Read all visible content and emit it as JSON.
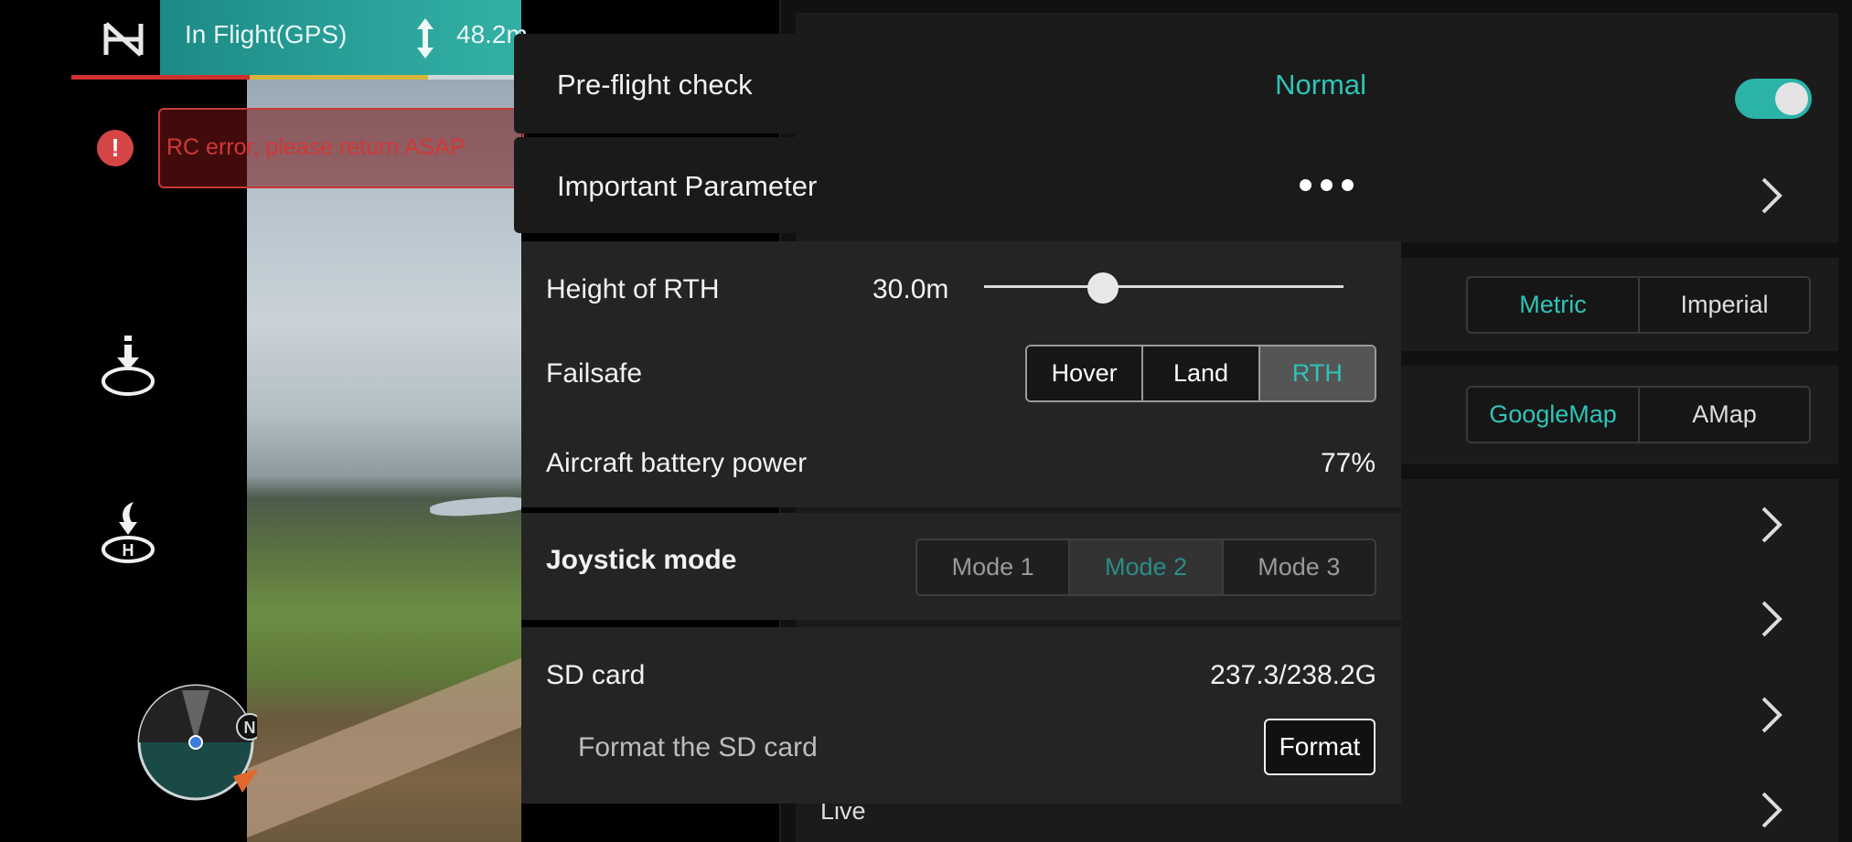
{
  "status": {
    "flight_mode": "In Flight(GPS)",
    "altitude": "48.2m"
  },
  "warning": {
    "icon_text": "!",
    "message": "RC error, please return ASAP"
  },
  "compass": {
    "north": "N"
  },
  "settings": {
    "toggle_on": true,
    "units": {
      "options": [
        "Metric",
        "Imperial"
      ],
      "selected": "Metric"
    },
    "map": {
      "options": [
        "GoogleMap",
        "AMap"
      ],
      "selected": "GoogleMap"
    },
    "live_label": "Live"
  },
  "quick_panel": {
    "preflight": {
      "label": "Pre-flight check",
      "status": "Normal"
    },
    "important_parameter": {
      "label": "Important Parameter"
    },
    "rth_height": {
      "label": "Height of RTH",
      "value": "30.0m",
      "level_fraction": 0.33
    },
    "failsafe": {
      "label": "Failsafe",
      "options": [
        "Hover",
        "Land",
        "RTH"
      ],
      "selected": "RTH"
    },
    "battery": {
      "label": "Aircraft battery power",
      "value": "77%"
    },
    "joystick": {
      "label": "Joystick mode",
      "options": [
        "Mode 1",
        "Mode 2",
        "Mode 3"
      ],
      "selected": "Mode 2"
    },
    "sd_card": {
      "label": "SD card",
      "value": "237.3/238.2G",
      "format_label": "Format the SD card",
      "format_button": "Format"
    }
  },
  "colors": {
    "accent": "#2ec4b8",
    "warning": "#d03838",
    "status_bar": "#2aa39a"
  }
}
